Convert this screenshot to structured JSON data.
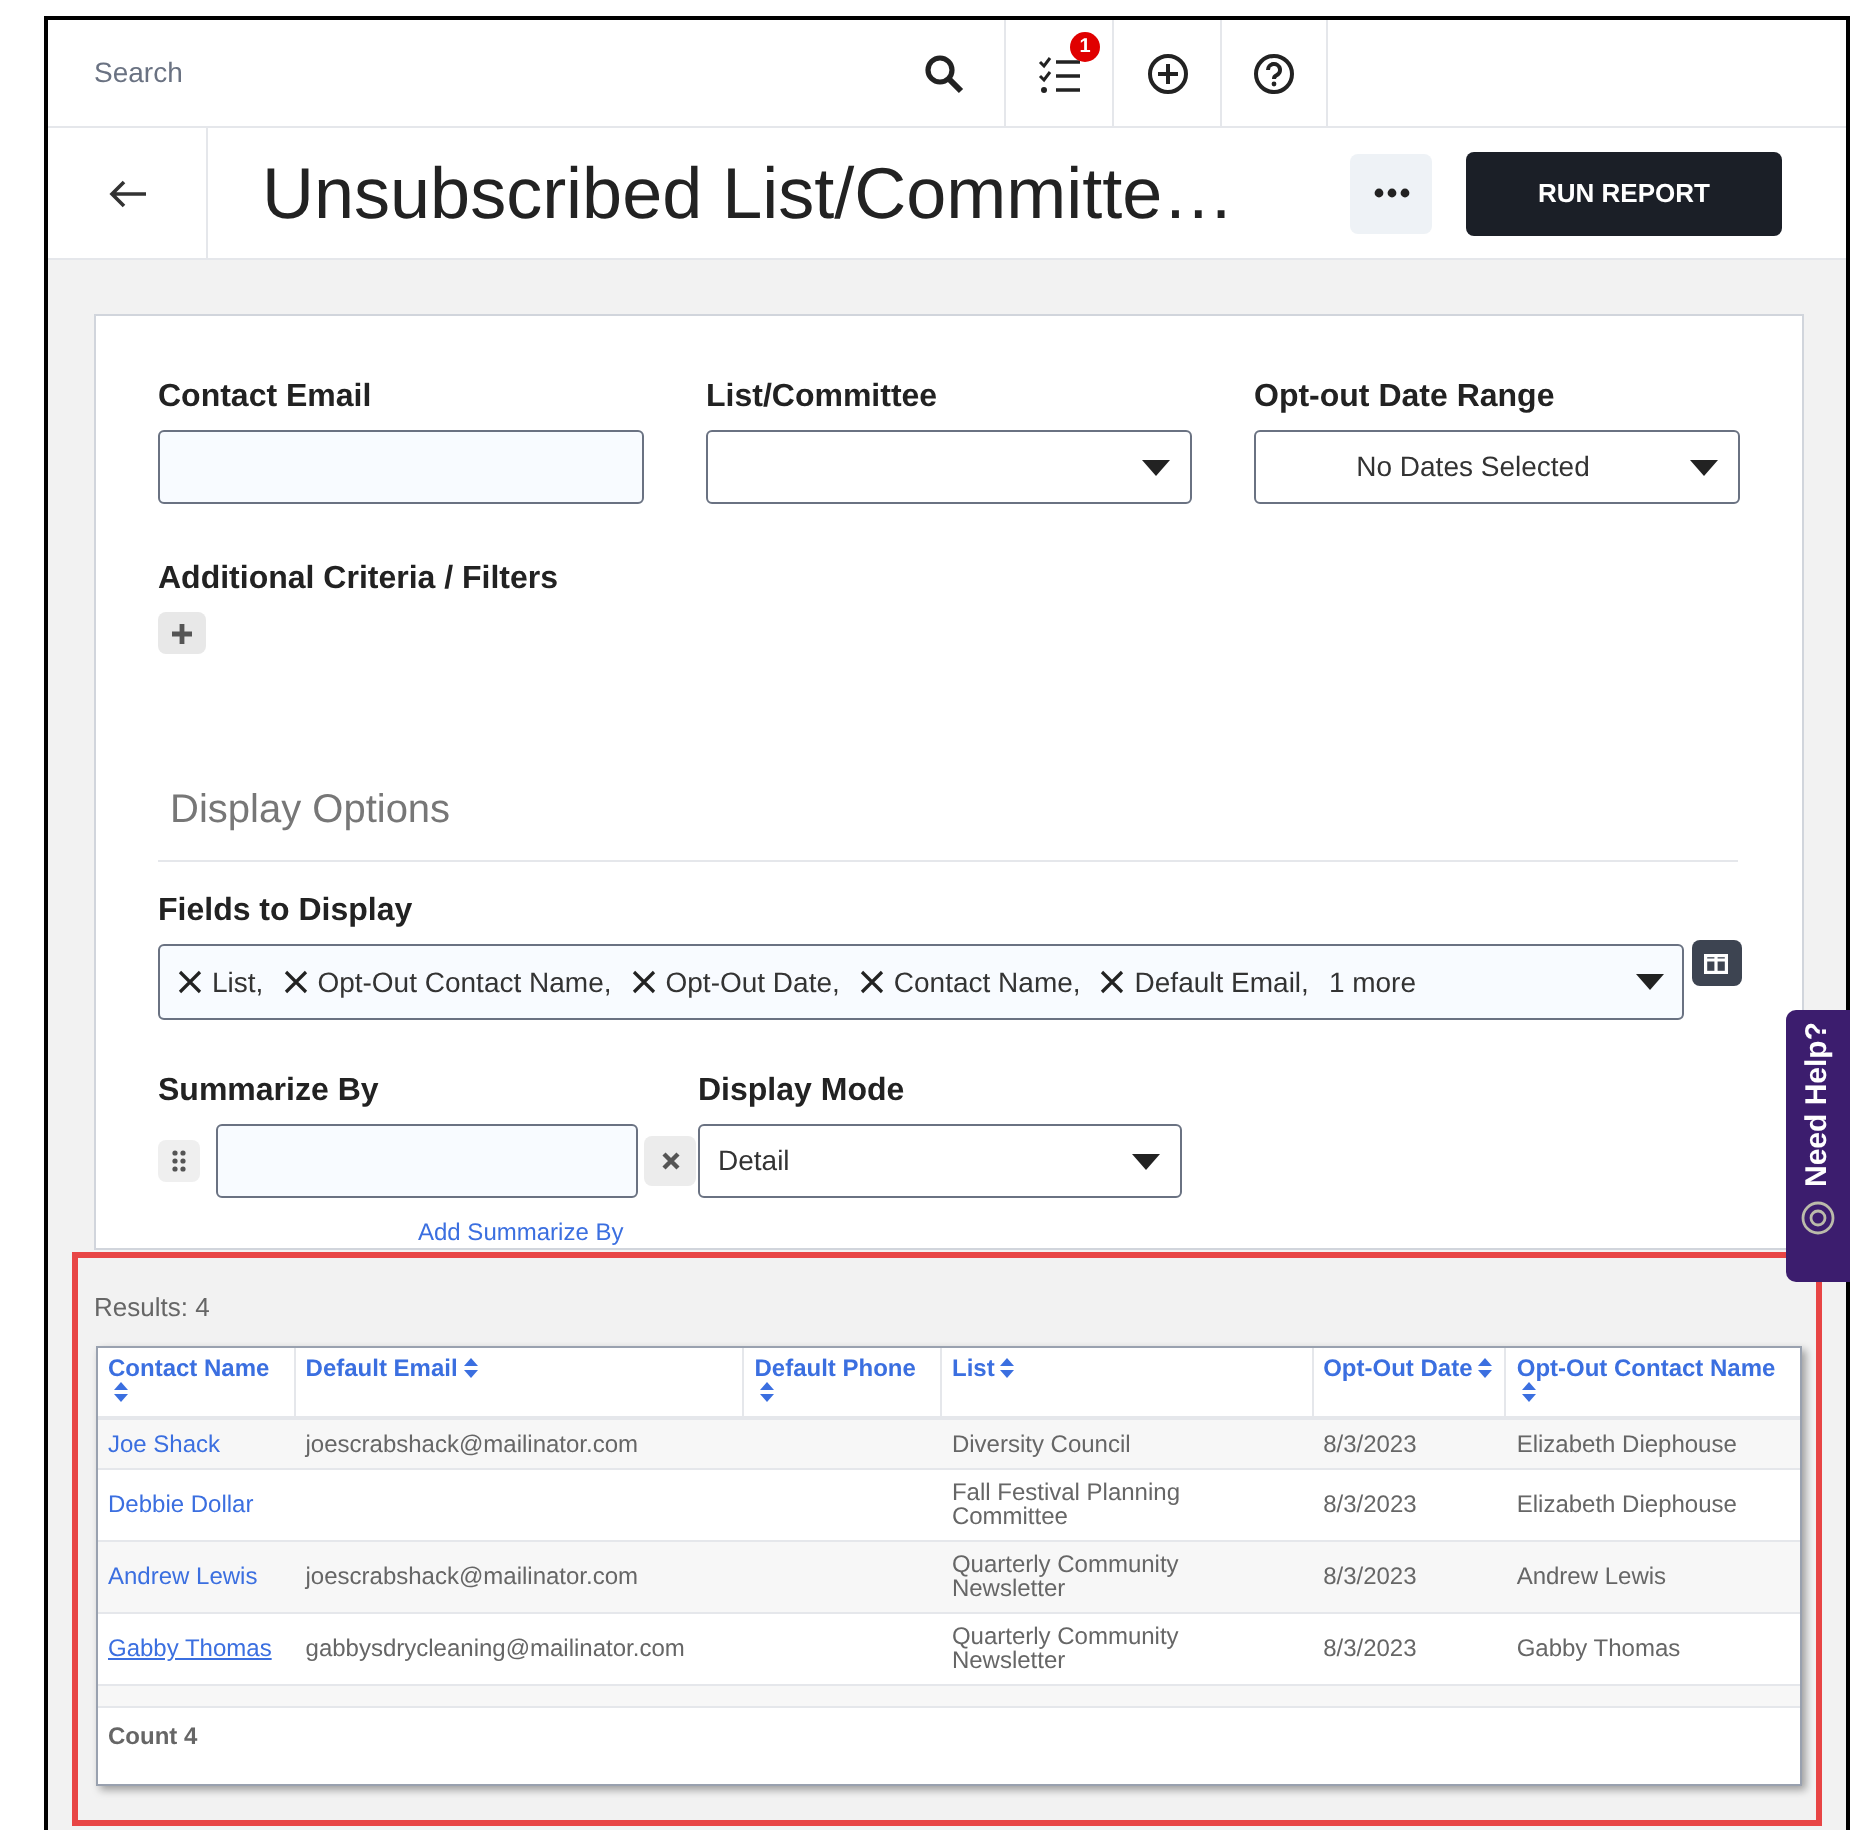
{
  "top_bar": {
    "search_placeholder": "Search",
    "tasks_badge": "1"
  },
  "header": {
    "title": "Unsubscribed List/Committe…",
    "run_button": "RUN REPORT"
  },
  "filters": [
    {
      "label": "Contact Email",
      "kind": "text"
    },
    {
      "label": "List/Committee",
      "kind": "dropdown"
    },
    {
      "label": "Opt-out Date Range",
      "kind": "dropdown",
      "value": "No Dates Selected"
    }
  ],
  "additional_criteria": {
    "label": "Additional Criteria / Filters"
  },
  "display_options": {
    "heading": "Display Options",
    "fields_label": "Fields to Display",
    "fields": [
      "List,",
      "Opt-Out Contact Name,",
      "Opt-Out Date,",
      "Contact Name,",
      "Default Email,"
    ],
    "more": "1 more",
    "summarize_label": "Summarize By",
    "add_summarize": "Add Summarize By",
    "display_mode_label": "Display Mode",
    "display_mode": "Detail"
  },
  "results": {
    "count_label": "Results: 4",
    "columns": [
      "Contact Name",
      "Default Email",
      "Default Phone",
      "List",
      "Opt-Out Date",
      "Opt-Out Contact Name"
    ],
    "rows": [
      {
        "contact_name": "Joe Shack",
        "hovered": false,
        "default_email": "joescrabshack@mailinator.com",
        "list": "Diversity Council",
        "opt_out_date": "8/3/2023",
        "opt_out_contact_name": "Elizabeth Diephouse"
      },
      {
        "contact_name": "Debbie Dollar",
        "hovered": false,
        "list": "Fall Festival Planning Committee",
        "opt_out_date": "8/3/2023",
        "opt_out_contact_name": "Elizabeth Diephouse"
      },
      {
        "contact_name": "Andrew Lewis",
        "hovered": false,
        "default_email": "joescrabshack@mailinator.com",
        "list": "Quarterly Community Newsletter",
        "opt_out_date": "8/3/2023",
        "opt_out_contact_name": "Andrew Lewis"
      },
      {
        "contact_name": "Gabby Thomas",
        "hovered": true,
        "default_email": "gabbysdrycleaning@mailinator.com",
        "list": "Quarterly Community Newsletter",
        "opt_out_date": "8/3/2023",
        "opt_out_contact_name": "Gabby Thomas"
      }
    ],
    "footer": "Count 4"
  },
  "need_help": "Need Help?"
}
